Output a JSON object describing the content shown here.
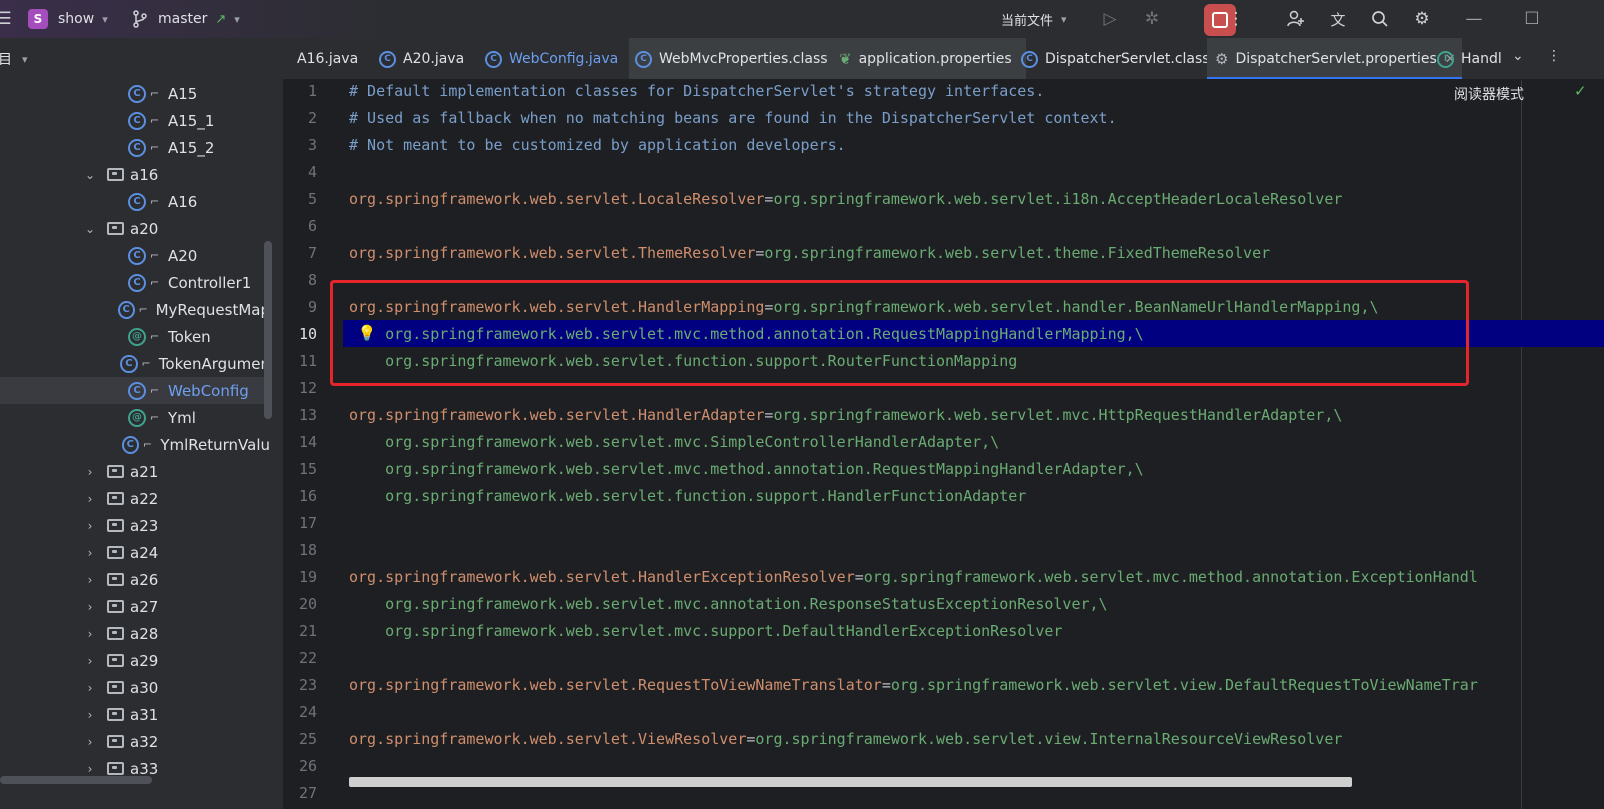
{
  "titlebar": {
    "project_badge": "S",
    "project_name": "show",
    "branch": "master",
    "run_config": "当前文件",
    "icons": [
      "menu-icon",
      "branch-icon",
      "run-icon",
      "debug-icon",
      "stop-icon",
      "more-icon",
      "add-user-icon",
      "translate-icon",
      "search-icon",
      "settings-icon",
      "minimize-icon",
      "maximize-icon"
    ]
  },
  "sidebar": {
    "header": "目",
    "items": [
      {
        "label": "A15",
        "kind": "class"
      },
      {
        "label": "A15_1",
        "kind": "class"
      },
      {
        "label": "A15_2",
        "kind": "class"
      },
      {
        "label": "a16",
        "kind": "folder",
        "expanded": true
      },
      {
        "label": "A16",
        "kind": "class"
      },
      {
        "label": "a20",
        "kind": "folder",
        "expanded": true
      },
      {
        "label": "A20",
        "kind": "class"
      },
      {
        "label": "Controller1",
        "kind": "class"
      },
      {
        "label": "MyRequestMap",
        "kind": "class"
      },
      {
        "label": "Token",
        "kind": "annotation"
      },
      {
        "label": "TokenArgumen",
        "kind": "class"
      },
      {
        "label": "WebConfig",
        "kind": "class",
        "selected": true
      },
      {
        "label": "Yml",
        "kind": "annotation"
      },
      {
        "label": "YmlReturnValu",
        "kind": "class"
      },
      {
        "label": "a21",
        "kind": "folder"
      },
      {
        "label": "a22",
        "kind": "folder"
      },
      {
        "label": "a23",
        "kind": "folder"
      },
      {
        "label": "a24",
        "kind": "folder"
      },
      {
        "label": "a26",
        "kind": "folder"
      },
      {
        "label": "a27",
        "kind": "folder"
      },
      {
        "label": "a28",
        "kind": "folder"
      },
      {
        "label": "a29",
        "kind": "folder"
      },
      {
        "label": "a30",
        "kind": "folder"
      },
      {
        "label": "a31",
        "kind": "folder"
      },
      {
        "label": "a32",
        "kind": "folder"
      },
      {
        "label": "a33",
        "kind": "folder"
      }
    ]
  },
  "tabs": [
    {
      "label": "A16.java"
    },
    {
      "label": "A20.java"
    },
    {
      "label": "WebConfig.java"
    },
    {
      "label": "WebMvcProperties.class"
    },
    {
      "label": "application.properties"
    },
    {
      "label": "DispatcherServlet.class"
    },
    {
      "label": "DispatcherServlet.properties",
      "active": true
    },
    {
      "label": "Handl"
    }
  ],
  "editor": {
    "reader_mode": "阅读器模式",
    "current_line": 10,
    "lines": [
      {
        "n": "1",
        "comment": "# Default implementation classes for DispatcherServlet's strategy interfaces."
      },
      {
        "n": "2",
        "comment": "# Used as fallback when no matching beans are found in the DispatcherServlet context."
      },
      {
        "n": "3",
        "comment": "# Not meant to be customized by application developers."
      },
      {
        "n": "4"
      },
      {
        "n": "5",
        "key": "org.springframework.web.servlet.LocaleResolver",
        "eq": "=",
        "val": "org.springframework.web.servlet.i18n.AcceptHeaderLocaleResolver"
      },
      {
        "n": "6"
      },
      {
        "n": "7",
        "key": "org.springframework.web.servlet.ThemeResolver",
        "eq": "=",
        "val": "org.springframework.web.servlet.theme.FixedThemeResolver"
      },
      {
        "n": "8"
      },
      {
        "n": "9",
        "key": "org.springframework.web.servlet.HandlerMapping",
        "eq": "=",
        "val": "org.springframework.web.servlet.handler.BeanNameUrlHandlerMapping,\\"
      },
      {
        "n": "10",
        "val": "    org.springframework.web.servlet.mvc.method.annotation.RequestMappingHandlerMapping,\\"
      },
      {
        "n": "11",
        "val": "    org.springframework.web.servlet.function.support.RouterFunctionMapping"
      },
      {
        "n": "12"
      },
      {
        "n": "13",
        "key": "org.springframework.web.servlet.HandlerAdapter",
        "eq": "=",
        "val": "org.springframework.web.servlet.mvc.HttpRequestHandlerAdapter,\\"
      },
      {
        "n": "14",
        "val": "    org.springframework.web.servlet.mvc.SimpleControllerHandlerAdapter,\\"
      },
      {
        "n": "15",
        "val": "    org.springframework.web.servlet.mvc.method.annotation.RequestMappingHandlerAdapter,\\"
      },
      {
        "n": "16",
        "val": "    org.springframework.web.servlet.function.support.HandlerFunctionAdapter"
      },
      {
        "n": "17"
      },
      {
        "n": "18"
      },
      {
        "n": "19",
        "key": "org.springframework.web.servlet.HandlerExceptionResolver",
        "eq": "=",
        "val": "org.springframework.web.servlet.mvc.method.annotation.ExceptionHandl"
      },
      {
        "n": "20",
        "val": "    org.springframework.web.servlet.mvc.annotation.ResponseStatusExceptionResolver,\\"
      },
      {
        "n": "21",
        "val": "    org.springframework.web.servlet.mvc.support.DefaultHandlerExceptionResolver"
      },
      {
        "n": "22"
      },
      {
        "n": "23",
        "key": "org.springframework.web.servlet.RequestToViewNameTranslator",
        "eq": "=",
        "val": "org.springframework.web.servlet.view.DefaultRequestToViewNameTrar"
      },
      {
        "n": "24"
      },
      {
        "n": "25",
        "key": "org.springframework.web.servlet.ViewResolver",
        "eq": "=",
        "val": "org.springframework.web.servlet.view.InternalResourceViewResolver"
      },
      {
        "n": "26"
      },
      {
        "n": "27"
      }
    ]
  },
  "colors": {
    "accent": "#3574f0",
    "highlight_box": "#e5242c",
    "current_line": "#000080",
    "comment": "#7a9eca",
    "key": "#cf8e6d",
    "value": "#6aab73"
  }
}
